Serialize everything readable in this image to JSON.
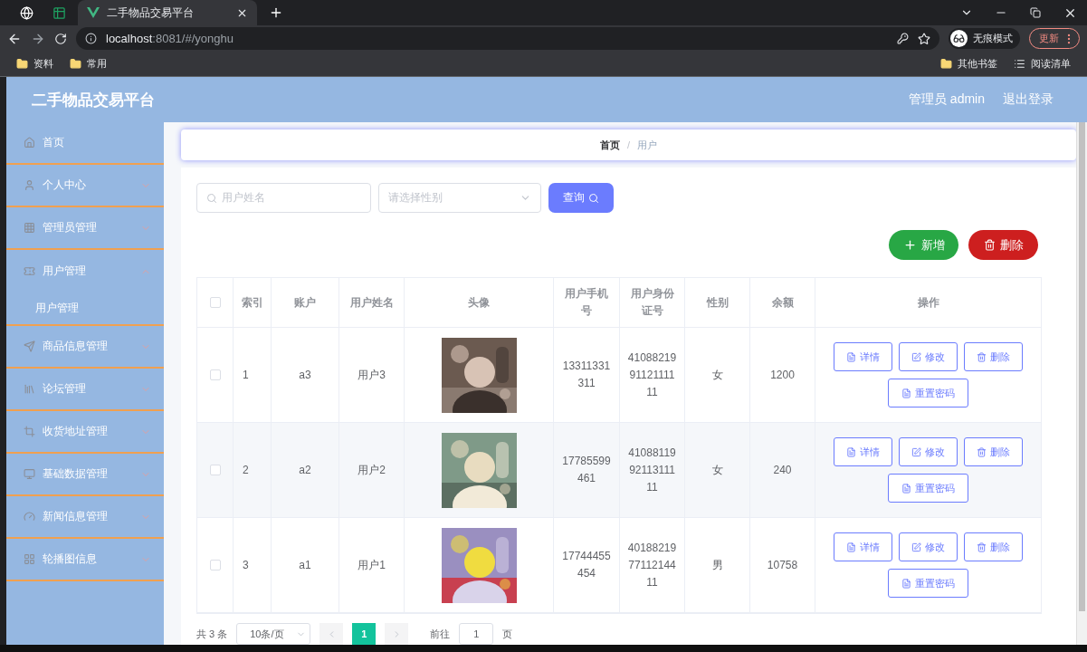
{
  "browser": {
    "tab_title": "二手物品交易平台",
    "url_host": "localhost",
    "url_path": ":8081/#/yonghu",
    "incognito_label": "无痕模式",
    "update_label": "更新",
    "bookmarks": [
      "资料",
      "常用"
    ],
    "other_bookmarks": "其他书签",
    "reading_list": "阅读清单"
  },
  "header": {
    "title": "二手物品交易平台",
    "user": "管理员 admin",
    "logout": "退出登录"
  },
  "sidebar": {
    "items": [
      {
        "label": "首页",
        "expanded": false,
        "has_arrow": false
      },
      {
        "label": "个人中心",
        "expanded": false,
        "has_arrow": true
      },
      {
        "label": "管理员管理",
        "expanded": false,
        "has_arrow": true
      },
      {
        "label": "用户管理",
        "expanded": true,
        "has_arrow": true,
        "children": [
          {
            "label": "用户管理"
          }
        ]
      },
      {
        "label": "商品信息管理",
        "expanded": false,
        "has_arrow": true
      },
      {
        "label": "论坛管理",
        "expanded": false,
        "has_arrow": true
      },
      {
        "label": "收货地址管理",
        "expanded": false,
        "has_arrow": true
      },
      {
        "label": "基础数据管理",
        "expanded": false,
        "has_arrow": true
      },
      {
        "label": "新闻信息管理",
        "expanded": false,
        "has_arrow": true
      },
      {
        "label": "轮播图信息",
        "expanded": false,
        "has_arrow": true
      }
    ]
  },
  "breadcrumb": [
    {
      "label": "首页"
    },
    {
      "label": "用户"
    }
  ],
  "breadcrumb_separator": "/",
  "search": {
    "name_placeholder": "用户姓名",
    "gender_placeholder": "请选择性别",
    "query_button": "查询"
  },
  "toolbar": {
    "add_button": "新增",
    "delete_button": "删除"
  },
  "table": {
    "select_all": false,
    "columns": [
      "索引",
      "账户",
      "用户姓名",
      "头像",
      "用户手机号",
      "用户身份证号",
      "性别",
      "余额",
      "操作"
    ],
    "rows": [
      {
        "checked": false,
        "index": "1",
        "account": "a3",
        "name": "用户3",
        "phone": "13311331311",
        "id_number": "410882199112111111",
        "gender": "女",
        "balance": "1200",
        "actions": [
          "详情",
          "修改",
          "删除",
          "重置密码"
        ]
      },
      {
        "checked": false,
        "index": "2",
        "account": "a2",
        "name": "用户2",
        "phone": "17785599461",
        "id_number": "410881199211311111",
        "gender": "女",
        "balance": "240",
        "actions": [
          "详情",
          "修改",
          "删除",
          "重置密码"
        ]
      },
      {
        "checked": false,
        "index": "3",
        "account": "a1",
        "name": "用户1",
        "phone": "17744455454",
        "id_number": "401882197711214411",
        "gender": "男",
        "balance": "10758",
        "actions": [
          "详情",
          "修改",
          "删除",
          "重置密码"
        ]
      }
    ]
  },
  "pagination": {
    "total": "共 3 条",
    "page_size": "10条/页",
    "pages": [
      {
        "label": "1",
        "selected": true
      }
    ],
    "goto_label": "前往",
    "goto_value": "1",
    "page_suffix": "页"
  }
}
